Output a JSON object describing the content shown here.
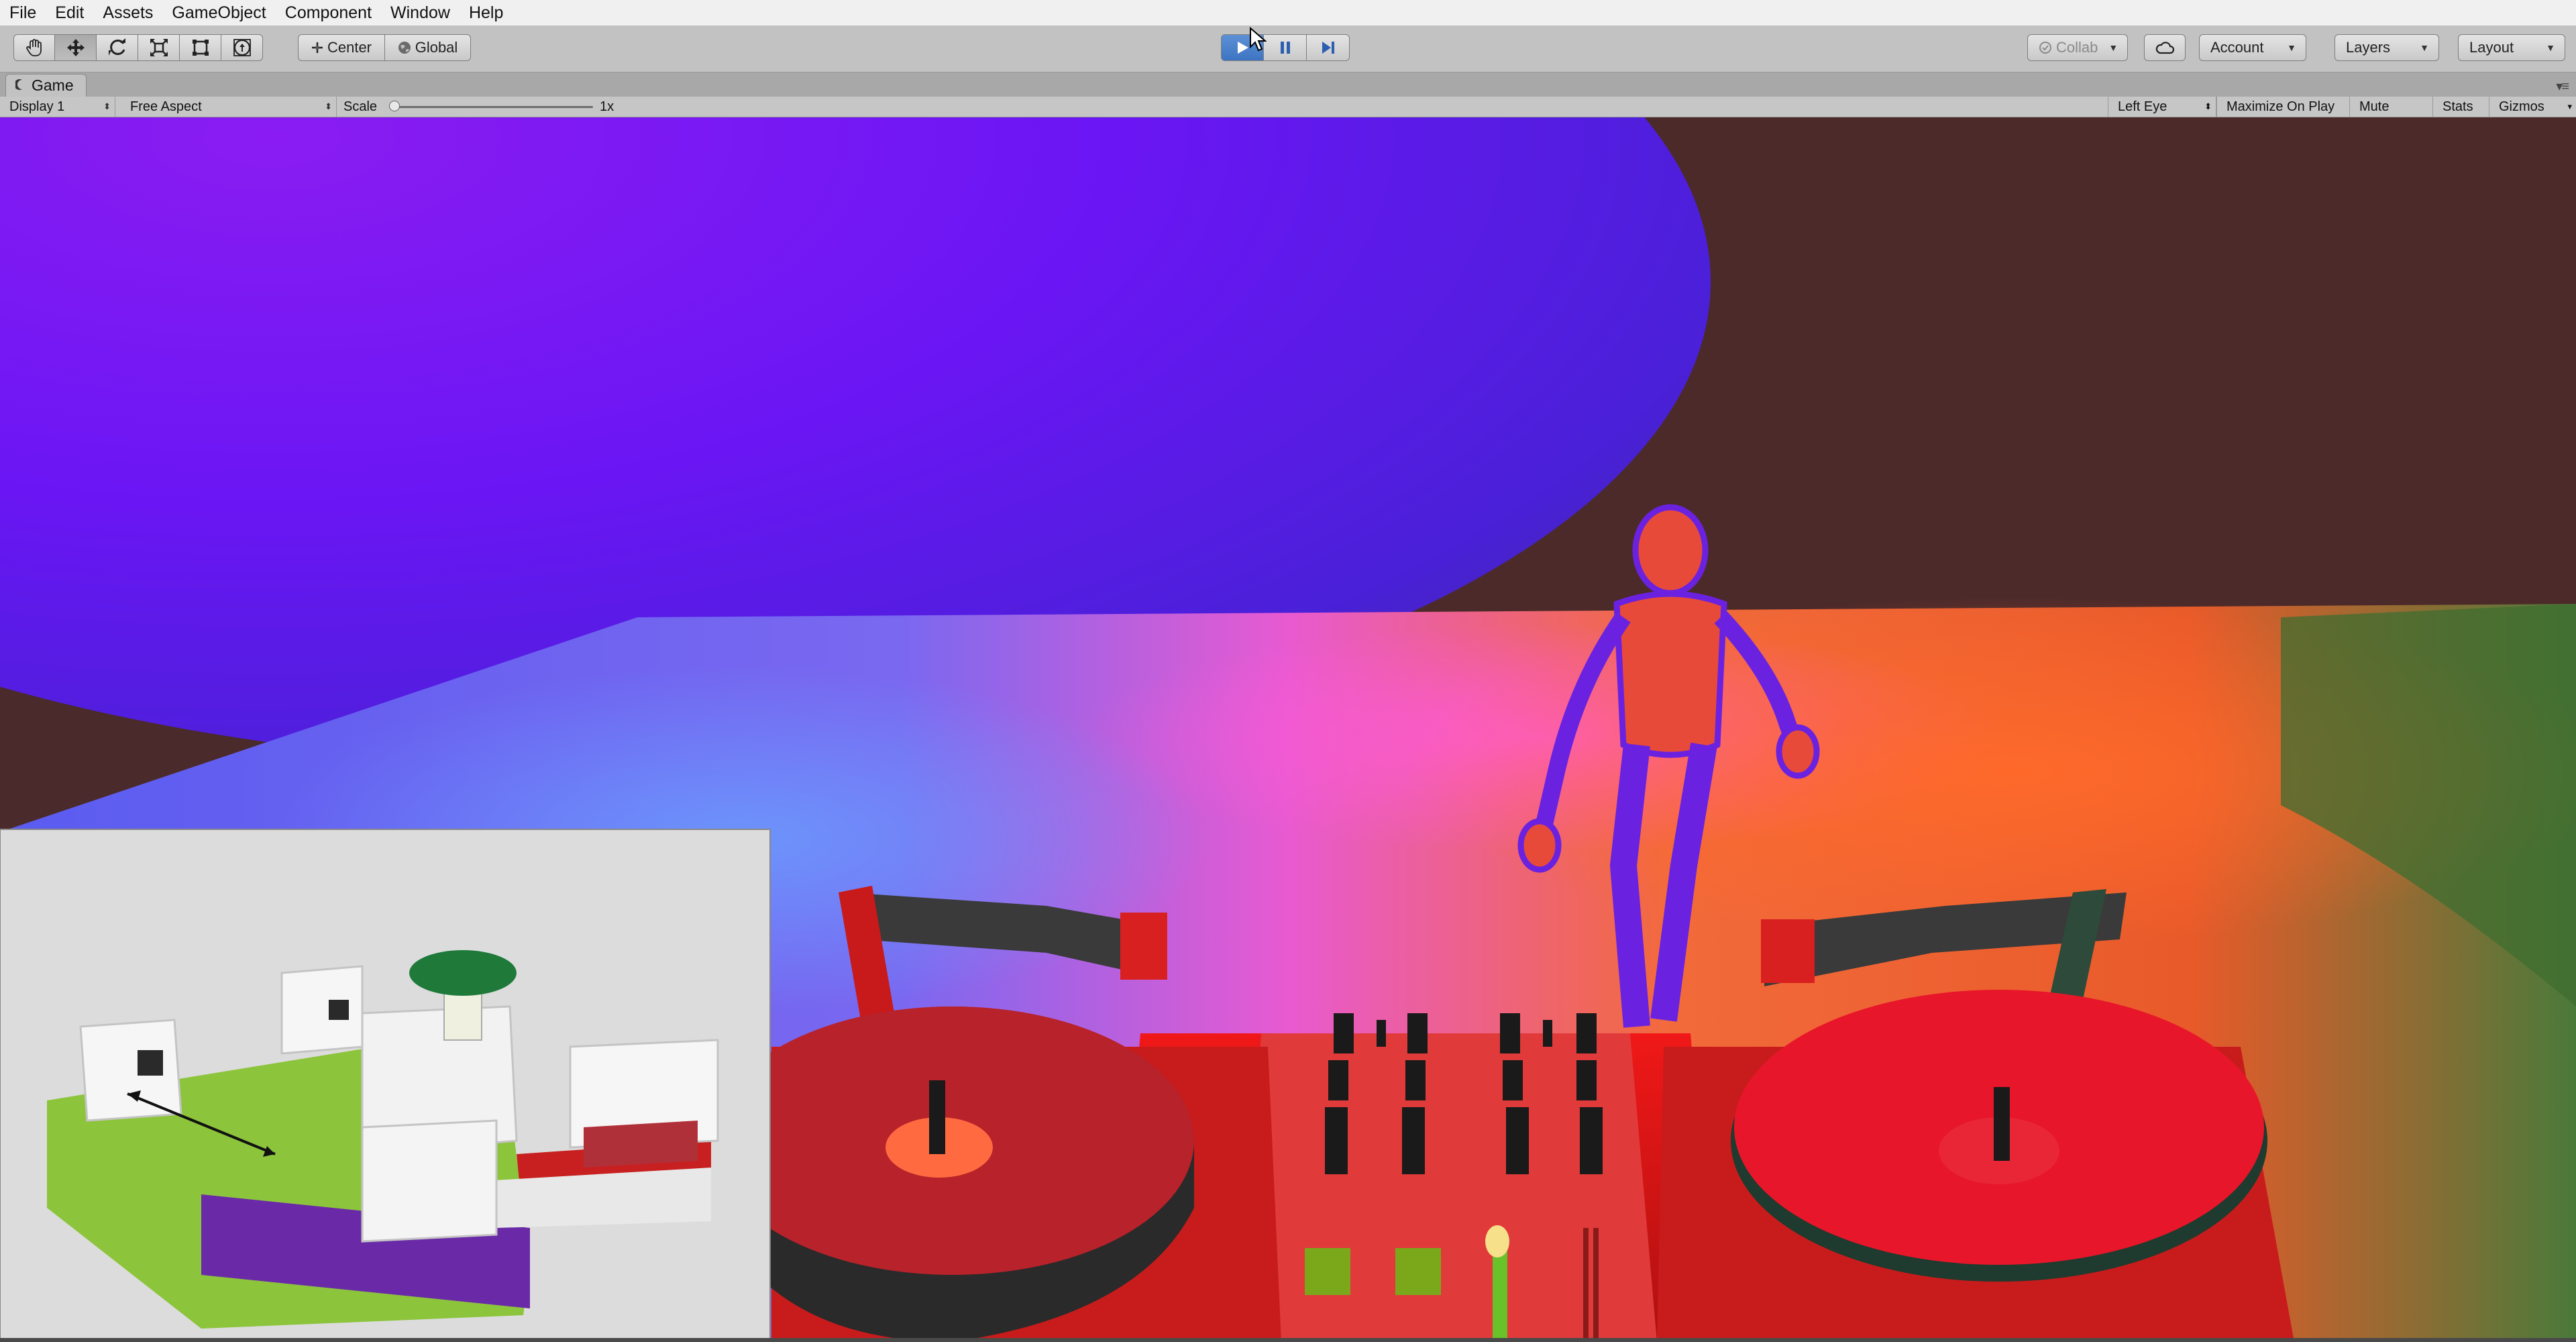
{
  "menu": [
    "File",
    "Edit",
    "Assets",
    "GameObject",
    "Component",
    "Window",
    "Help"
  ],
  "toolbar": {
    "tools": [
      {
        "name": "hand-tool-icon"
      },
      {
        "name": "move-tool-icon"
      },
      {
        "name": "rotate-tool-icon"
      },
      {
        "name": "scale-tool-icon"
      },
      {
        "name": "rect-tool-icon"
      },
      {
        "name": "transform-tool-icon"
      }
    ],
    "pivot_mode": "Center",
    "pivot_rotation": "Global",
    "play_controls": [
      "play-icon",
      "pause-icon",
      "step-icon"
    ],
    "play_active": true,
    "collab": "Collab",
    "account": "Account",
    "layers": "Layers",
    "layout": "Layout",
    "accent_color": "#3d74c2"
  },
  "game_view": {
    "tab_title": "Game",
    "display": "Display 1",
    "aspect": "Free Aspect",
    "scale_label": "Scale",
    "scale_value": "1x",
    "scale_level": 0.0,
    "eye": "Left Eye",
    "maximize_on_play": "Maximize On Play",
    "mute_audio": "Mute Audio",
    "stats": "Stats",
    "gizmos": "Gizmos"
  }
}
